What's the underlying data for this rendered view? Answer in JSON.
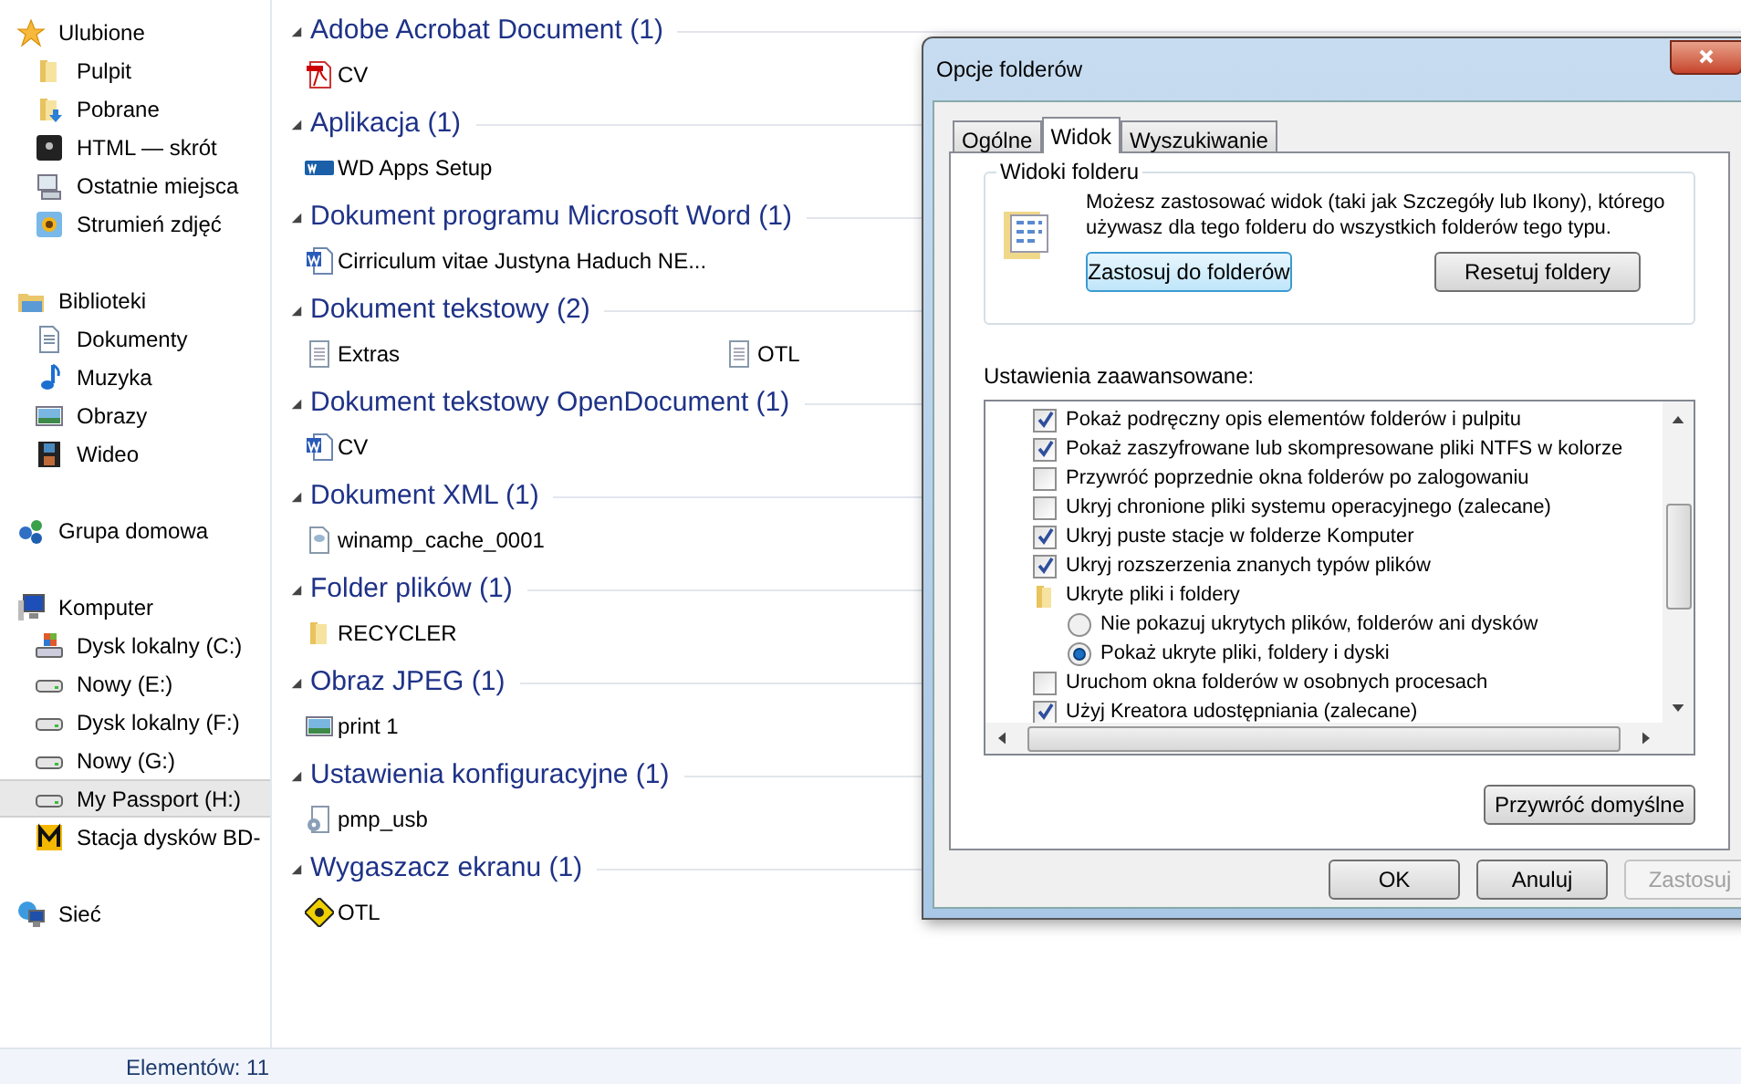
{
  "sidebar": {
    "sections": [
      {
        "header": {
          "label": "Ulubione",
          "kind": "star",
          "selected": false
        },
        "items": [
          {
            "label": "Pulpit",
            "kind": "folder",
            "selected": false
          },
          {
            "label": "Pobrane",
            "kind": "download",
            "selected": false
          },
          {
            "label": "HTML — skrót",
            "kind": "shortcut",
            "selected": false
          },
          {
            "label": "Ostatnie miejsca",
            "kind": "recent",
            "selected": false
          },
          {
            "label": "Strumień zdjęć",
            "kind": "photo",
            "selected": false
          }
        ]
      },
      {
        "header": {
          "label": "Biblioteki",
          "kind": "library",
          "selected": false
        },
        "items": [
          {
            "label": "Dokumenty",
            "kind": "document",
            "selected": false
          },
          {
            "label": "Muzyka",
            "kind": "music",
            "selected": false
          },
          {
            "label": "Obrazy",
            "kind": "image",
            "selected": false
          },
          {
            "label": "Wideo",
            "kind": "video",
            "selected": false
          }
        ]
      },
      {
        "header": {
          "label": "Grupa domowa",
          "kind": "homegroup",
          "selected": false
        }
      },
      {
        "header": {
          "label": "Komputer",
          "kind": "computer",
          "selected": false
        },
        "items": [
          {
            "label": "Dysk lokalny (C:)",
            "kind": "system-drive",
            "selected": false
          },
          {
            "label": "Nowy (E:)",
            "kind": "drive",
            "selected": false
          },
          {
            "label": "Dysk lokalny (F:)",
            "kind": "drive",
            "selected": false
          },
          {
            "label": "Nowy (G:)",
            "kind": "drive",
            "selected": false
          },
          {
            "label": "My Passport (H:)",
            "kind": "drive",
            "selected": true
          },
          {
            "label": "Stacja dysków BD-",
            "kind": "bd-drive",
            "selected": false
          }
        ]
      },
      {
        "header": {
          "label": "Sieć",
          "kind": "network",
          "selected": false
        }
      }
    ]
  },
  "groups": [
    {
      "title": "Adobe Acrobat Document (1)",
      "expanded": true,
      "files": [
        {
          "name": "CV",
          "kind": "pdf"
        }
      ]
    },
    {
      "title": "Aplikacja (1)",
      "expanded": true,
      "files": [
        {
          "name": "WD Apps Setup",
          "kind": "app"
        }
      ]
    },
    {
      "title": "Dokument programu Microsoft Word (1)",
      "expanded": true,
      "files": [
        {
          "name": "Cirriculum vitae Justyna  Haduch NE...",
          "kind": "word"
        }
      ]
    },
    {
      "title": "Dokument tekstowy (2)",
      "expanded": true,
      "files": [
        {
          "name": "Extras",
          "kind": "text"
        },
        {
          "name": "OTL",
          "kind": "text"
        }
      ]
    },
    {
      "title": "Dokument tekstowy OpenDocument (1)",
      "expanded": true,
      "files": [
        {
          "name": "CV",
          "kind": "word"
        }
      ]
    },
    {
      "title": "Dokument XML (1)",
      "expanded": true,
      "files": [
        {
          "name": "winamp_cache_0001",
          "kind": "xml"
        }
      ]
    },
    {
      "title": "Folder plików (1)",
      "expanded": true,
      "files": [
        {
          "name": "RECYCLER",
          "kind": "folder"
        }
      ]
    },
    {
      "title": "Obraz JPEG (1)",
      "expanded": true,
      "files": [
        {
          "name": "print 1",
          "kind": "image"
        }
      ]
    },
    {
      "title": "Ustawienia konfiguracyjne (1)",
      "expanded": true,
      "files": [
        {
          "name": "pmp_usb",
          "kind": "config"
        }
      ]
    },
    {
      "title": "Wygaszacz ekranu (1)",
      "expanded": true,
      "files": [
        {
          "name": "OTL",
          "kind": "screensaver"
        }
      ]
    }
  ],
  "status_bar": {
    "text": "Elementów: 11"
  },
  "dialog": {
    "title": "Opcje folderów",
    "tabs": [
      {
        "label": "Ogólne",
        "selected": false
      },
      {
        "label": "Widok",
        "selected": true
      },
      {
        "label": "Wyszukiwanie",
        "selected": false
      }
    ],
    "folder_views": {
      "legend": "Widoki folderu",
      "description": "Możesz zastosować widok (taki jak Szczegóły lub Ikony), którego używasz dla tego folderu do wszystkich folderów tego typu.",
      "buttons": [
        {
          "label": "Zastosuj do folderów",
          "focused": true
        },
        {
          "label": "Resetuj foldery",
          "focused": false
        }
      ]
    },
    "advanced_label": "Ustawienia zaawansowane:",
    "settings": [
      {
        "kind": "checkbox",
        "label": "Pokaż podręczny opis elementów folderów i pulpitu",
        "checked": true
      },
      {
        "kind": "checkbox",
        "label": "Pokaż zaszyfrowane lub skompresowane pliki NTFS w kolorze",
        "checked": true
      },
      {
        "kind": "checkbox",
        "label": "Przywróć poprzednie okna folderów po zalogowaniu",
        "checked": false
      },
      {
        "kind": "checkbox",
        "label": "Ukryj chronione pliki systemu operacyjnego (zalecane)",
        "checked": false
      },
      {
        "kind": "checkbox",
        "label": "Ukryj puste stacje w folderze Komputer",
        "checked": true
      },
      {
        "kind": "checkbox",
        "label": "Ukryj rozszerzenia znanych typów plików",
        "checked": true
      },
      {
        "kind": "folder",
        "label": "Ukryte pliki i foldery",
        "children": [
          {
            "kind": "radio",
            "label": "Nie pokazuj ukrytych plików, folderów ani dysków",
            "selected": false
          },
          {
            "kind": "radio",
            "label": "Pokaż ukryte pliki, foldery i dyski",
            "selected": true
          }
        ]
      },
      {
        "kind": "checkbox",
        "label": "Uruchom okna folderów w osobnych procesach",
        "checked": false
      },
      {
        "kind": "checkbox",
        "label": "Użyj Kreatora udostępniania (zalecane)",
        "checked": true
      }
    ],
    "restore_button": {
      "label": "Przywróć domyślne",
      "disabled": false
    },
    "buttons": [
      {
        "label": "OK",
        "disabled": false
      },
      {
        "label": "Anuluj",
        "disabled": false
      },
      {
        "label": "Zastosuj",
        "disabled": true
      }
    ]
  }
}
